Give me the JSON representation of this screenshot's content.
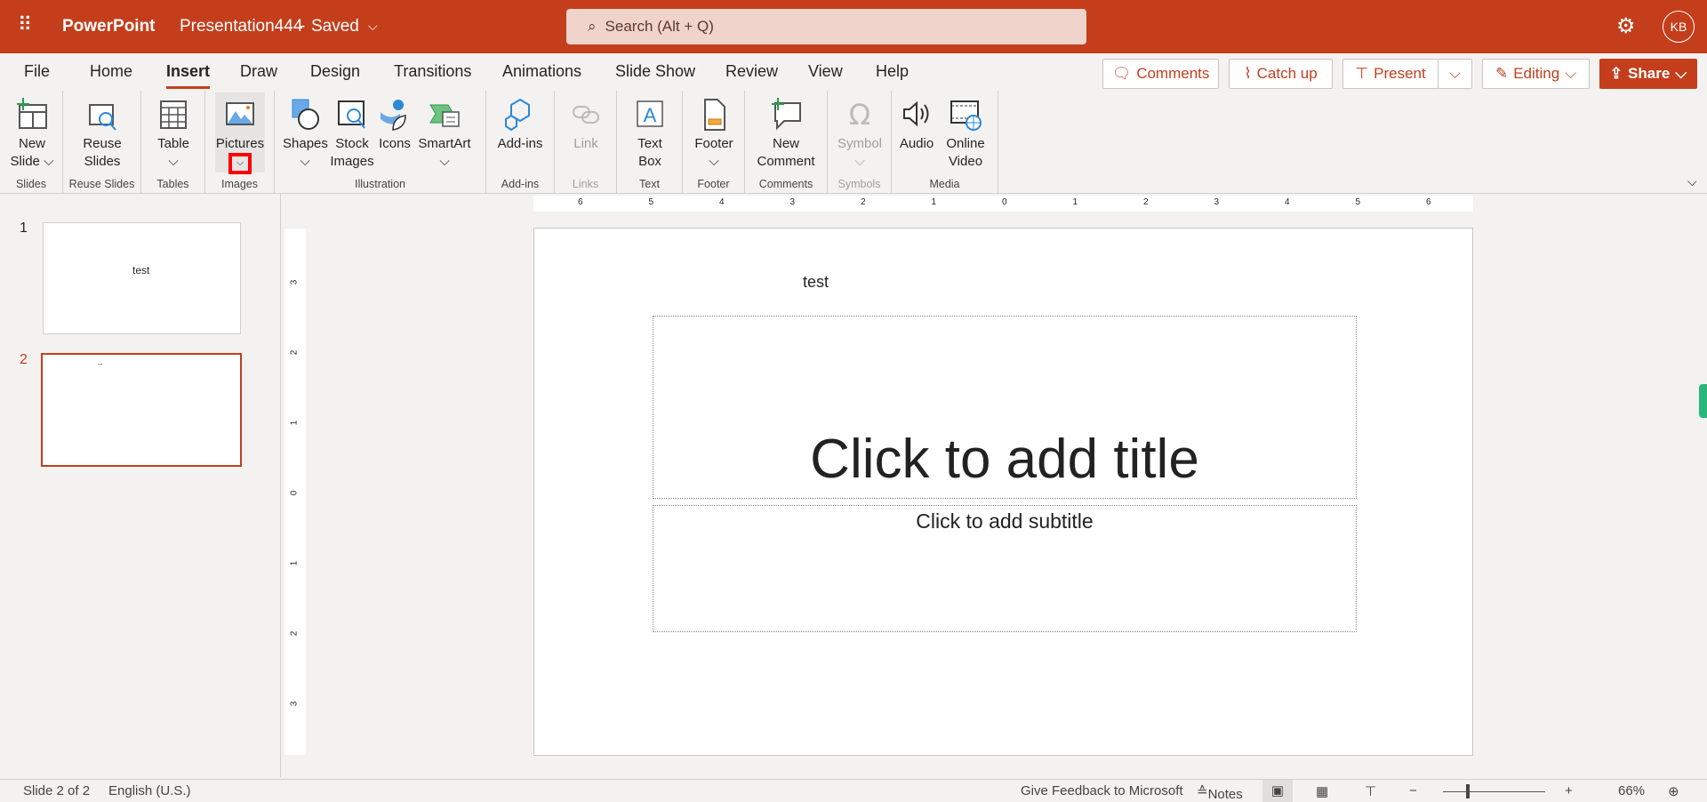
{
  "app": {
    "name": "PowerPoint",
    "doc_title": "Presentation444",
    "save_status": "Saved",
    "search_placeholder": "Search (Alt + Q)",
    "avatar_initials": "KB",
    "accent": "#c43e1c"
  },
  "tabs": [
    "File",
    "Home",
    "Insert",
    "Draw",
    "Design",
    "Transitions",
    "Animations",
    "Slide Show",
    "Review",
    "View",
    "Help"
  ],
  "active_tab": "Insert",
  "actions": {
    "comments": "Comments",
    "catch_up": "Catch up",
    "present": "Present",
    "editing": "Editing",
    "share": "Share"
  },
  "ribbon": {
    "groups": [
      "Slides",
      "Reuse Slides",
      "Tables",
      "Images",
      "Illustration",
      "Add-ins",
      "Links",
      "Text",
      "Footer",
      "Comments",
      "Symbols",
      "Media"
    ],
    "buttons": {
      "new_slide_1": "New",
      "new_slide_2": "Slide",
      "reuse_1": "Reuse",
      "reuse_2": "Slides",
      "table": "Table",
      "pictures": "Pictures",
      "shapes": "Shapes",
      "stock_1": "Stock",
      "stock_2": "Images",
      "icons": "Icons",
      "smartart": "SmartArt",
      "addins": "Add-ins",
      "link": "Link",
      "textbox_1": "Text",
      "textbox_2": "Box",
      "footer": "Footer",
      "comment_1": "New",
      "comment_2": "Comment",
      "symbol": "Symbol",
      "audio": "Audio",
      "video_1": "Online",
      "video_2": "Video"
    }
  },
  "slides": [
    {
      "number": "1",
      "text": "test"
    },
    {
      "number": "2",
      "text": "--"
    }
  ],
  "current_slide": {
    "text": "test",
    "title_placeholder": "Click to add title",
    "subtitle_placeholder": "Click to add subtitle"
  },
  "ruler": {
    "h": [
      "6",
      "5",
      "4",
      "3",
      "2",
      "1",
      "0",
      "1",
      "2",
      "3",
      "4",
      "5",
      "6"
    ],
    "v": [
      "3",
      "2",
      "1",
      "0",
      "1",
      "2",
      "3"
    ]
  },
  "status": {
    "slide": "Slide 2 of 2",
    "language": "English (U.S.)",
    "feedback": "Give Feedback to Microsoft",
    "notes": "Notes",
    "zoom": "66%",
    "zoom_level": 66
  }
}
